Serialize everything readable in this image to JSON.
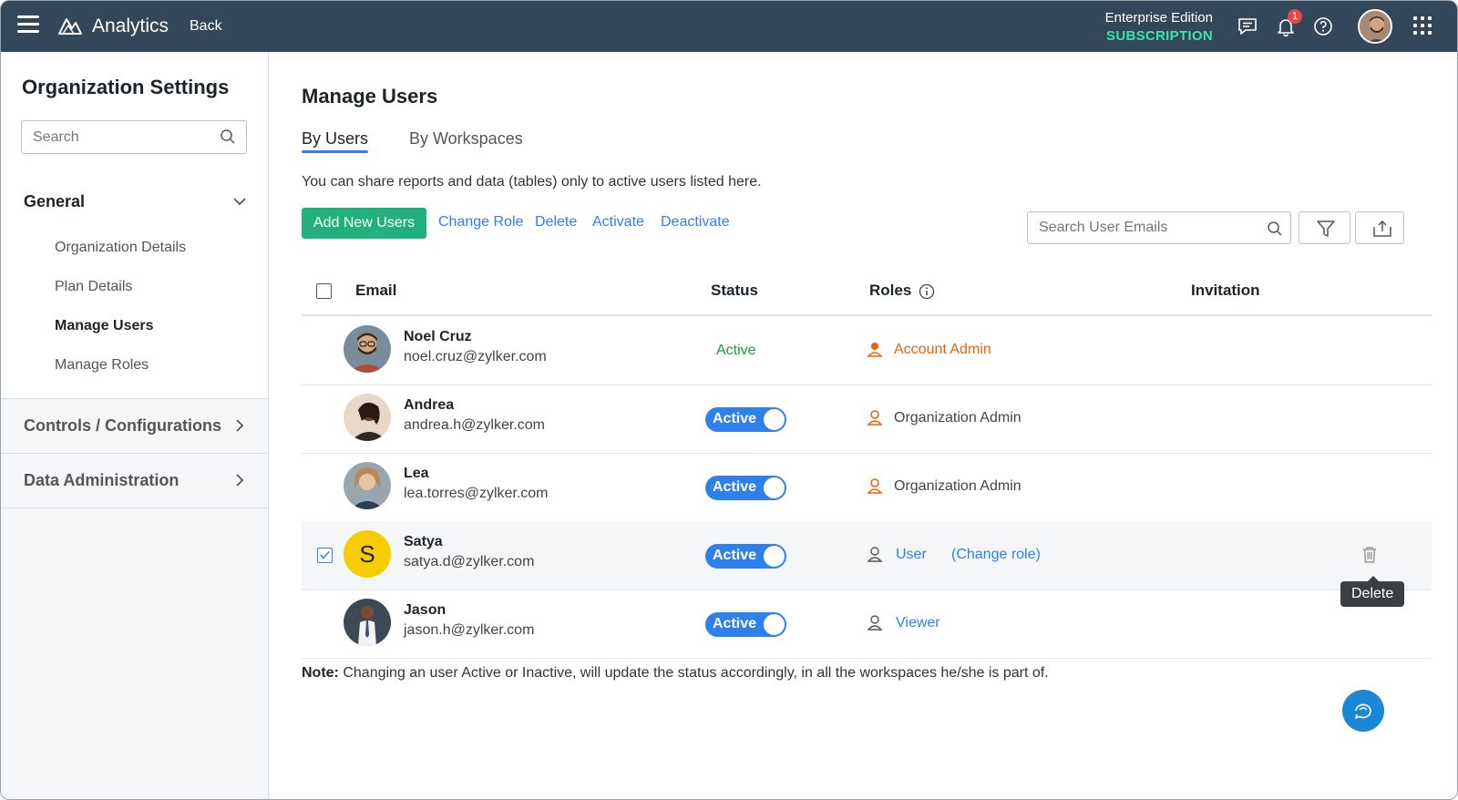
{
  "topbar": {
    "app_title": "Analytics",
    "back_label": "Back",
    "edition_line1": "Enterprise Edition",
    "edition_line2": "SUBSCRIPTION",
    "notification_count": "1",
    "icons": [
      "menu-icon",
      "analytics-logo-icon",
      "feedback-icon",
      "bell-icon",
      "help-icon",
      "avatar",
      "apps-grid-icon"
    ]
  },
  "sidebar": {
    "title": "Organization Settings",
    "search_placeholder": "Search",
    "general": {
      "label": "General",
      "items": [
        {
          "label": "Organization Details",
          "active": false
        },
        {
          "label": "Plan Details",
          "active": false
        },
        {
          "label": "Manage Users",
          "active": true
        },
        {
          "label": "Manage Roles",
          "active": false
        }
      ]
    },
    "groups": [
      {
        "label": "Controls / Configurations"
      },
      {
        "label": "Data Administration"
      }
    ]
  },
  "main": {
    "title": "Manage Users",
    "tabs": [
      {
        "label": "By Users",
        "active": true
      },
      {
        "label": "By Workspaces",
        "active": false
      }
    ],
    "hint": "You can share reports and data (tables) only to active users listed here.",
    "actions": {
      "add": "Add New Users",
      "change_role": "Change Role",
      "delete": "Delete",
      "activate": "Activate",
      "deactivate": "Deactivate"
    },
    "email_search_placeholder": "Search User Emails",
    "columns": {
      "email": "Email",
      "status": "Status",
      "roles": "Roles",
      "invitation": "Invitation"
    },
    "users": [
      {
        "name": "Noel Cruz",
        "email": "noel.cruz@zylker.com",
        "status": "Active",
        "role": "Account Admin",
        "selected": false
      },
      {
        "name": "Andrea",
        "email": "andrea.h@zylker.com",
        "status": "Active",
        "role": "Organization Admin",
        "selected": false
      },
      {
        "name": "Lea",
        "email": "lea.torres@zylker.com",
        "status": "Active",
        "role": "Organization Admin",
        "selected": false
      },
      {
        "name": "Satya",
        "email": "satya.d@zylker.com",
        "status": "Active",
        "role": "User",
        "change_role": "(Change role)",
        "avatar_letter": "S",
        "selected": true
      },
      {
        "name": "Jason",
        "email": "jason.h@zylker.com",
        "status": "Active",
        "role": "Viewer",
        "selected": false
      }
    ],
    "tooltip": "Delete",
    "note_label": "Note:",
    "note_text": " Changing an user Active or Inactive, will update the status accordingly, in all the workspaces he/she is part of."
  },
  "colors": {
    "topbar": "#33475b",
    "accent_green": "#22b07d",
    "link_blue": "#2f80ed",
    "admin_orange": "#e8620c",
    "subscription_green": "#3ee3a8",
    "active_text_green": "#1a9a3f"
  }
}
